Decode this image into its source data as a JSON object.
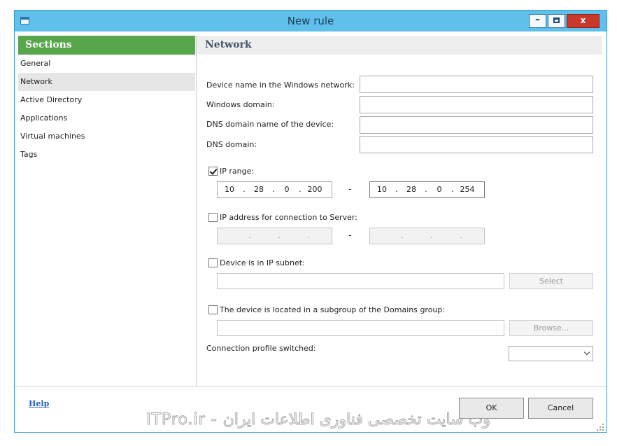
{
  "window": {
    "title": "New rule",
    "controls": {
      "minimize": "–",
      "close": "x"
    }
  },
  "sidebar": {
    "header": "Sections",
    "items": [
      {
        "label": "General",
        "selected": false
      },
      {
        "label": "Network",
        "selected": true
      },
      {
        "label": "Active Directory",
        "selected": false
      },
      {
        "label": "Applications",
        "selected": false
      },
      {
        "label": "Virtual machines",
        "selected": false
      },
      {
        "label": "Tags",
        "selected": false
      }
    ]
  },
  "main": {
    "header": "Network",
    "fields": {
      "device_name_label": "Device name in the Windows network:",
      "device_name_value": "",
      "windows_domain_label": "Windows domain:",
      "windows_domain_value": "",
      "dns_domain_name_label": "DNS domain name of the device:",
      "dns_domain_name_value": "",
      "dns_domain_label": "DNS domain:",
      "dns_domain_value": ""
    },
    "ip_range": {
      "label": "IP range:",
      "checked": true,
      "from": [
        "10",
        "28",
        "0",
        "200"
      ],
      "to": [
        "10",
        "28",
        "0",
        "254"
      ],
      "separator": "-"
    },
    "ip_server": {
      "label": "IP address for connection to Server:",
      "checked": false,
      "separator": "-"
    },
    "ip_subnet": {
      "label": "Device is in IP subnet:",
      "checked": false,
      "button": "Select"
    },
    "domains_subgroup": {
      "label": "The device is located in a subgroup of the Domains group:",
      "checked": false,
      "button": "Browse..."
    },
    "connection_profile": {
      "label": "Connection profile switched:",
      "selected": ""
    }
  },
  "footer": {
    "help": "Help",
    "ok": "OK",
    "cancel": "Cancel"
  },
  "watermark": "ITPro.ir - وب سایت تخصصی فناوری اطلاعات ایران",
  "colors": {
    "titlebar": "#60c0ec",
    "sidebar_header": "#58a64c",
    "close_button": "#c8392b",
    "help_link": "#1f5fbf"
  }
}
